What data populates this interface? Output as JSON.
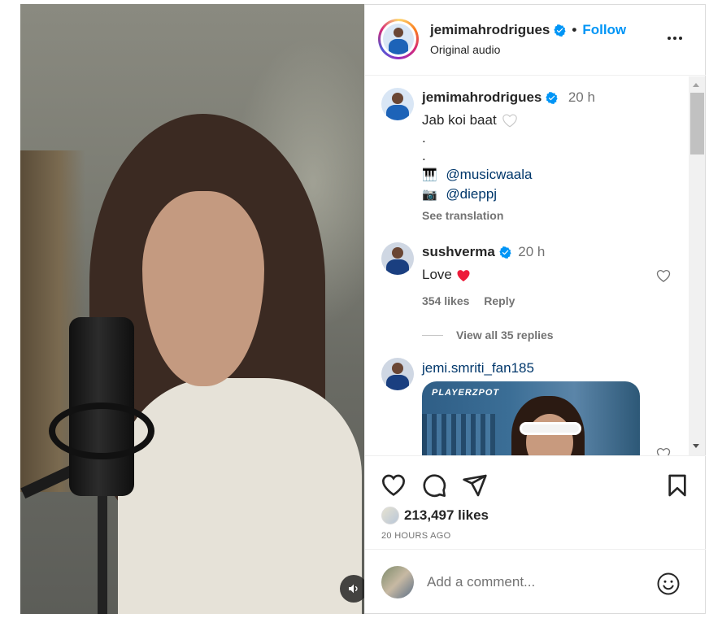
{
  "post": {
    "username": "jemimahrodrigues",
    "follow_label": "Follow",
    "separator": "•",
    "audio_label": "Original audio"
  },
  "caption": {
    "username": "jemimahrodrigues",
    "time": "20 h",
    "line1": "Jab koi baat",
    "dot1": ".",
    "dot2": ".",
    "music_emoji": "🎹",
    "music_mention": "@musicwaala",
    "camera_emoji": "📷",
    "camera_mention": "@dieppj",
    "see_translation": "See translation"
  },
  "comments": [
    {
      "username": "sushverma",
      "time": "20 h",
      "text": "Love",
      "emoji": "❤️",
      "likes": "354 likes",
      "reply": "Reply",
      "view_replies": "View all 35 replies"
    },
    {
      "username": "jemi.smriti_fan185",
      "media_brand": "PLAYERZPOT"
    }
  ],
  "actions": {
    "likes": "213,497 likes",
    "time_ago": "20 HOURS AGO"
  },
  "add_comment": {
    "placeholder": "Add a comment..."
  },
  "colors": {
    "accent": "#0095f6",
    "mention": "#00376b",
    "heart_red": "#ed4956",
    "verified": "#0095f6"
  },
  "icons": [
    "verified-icon",
    "more-icon",
    "heart-icon",
    "comment-icon",
    "share-icon",
    "bookmark-icon",
    "emoji-icon",
    "volume-icon"
  ]
}
